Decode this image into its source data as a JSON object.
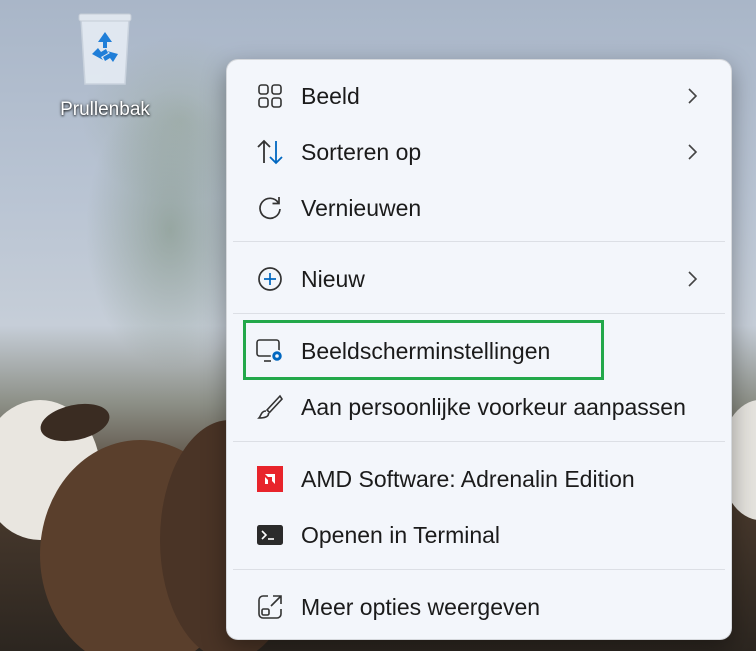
{
  "desktop": {
    "recycle_bin_label": "Prullenbak"
  },
  "menu": {
    "items": [
      {
        "label": "Beeld",
        "icon": "grid-icon",
        "submenu": true
      },
      {
        "label": "Sorteren op",
        "icon": "sort-arrows-icon",
        "submenu": true
      },
      {
        "label": "Vernieuwen",
        "icon": "refresh-icon",
        "submenu": false
      },
      {
        "label": "Nieuw",
        "icon": "plus-circle-icon",
        "submenu": true
      },
      {
        "label": "Beeldscherminstellingen",
        "icon": "display-settings-icon",
        "submenu": false,
        "highlighted": true
      },
      {
        "label": "Aan persoonlijke voorkeur aanpassen",
        "icon": "brush-icon",
        "submenu": false
      },
      {
        "label": "AMD Software: Adrenalin Edition",
        "icon": "amd-logo-icon",
        "submenu": false
      },
      {
        "label": "Openen in Terminal",
        "icon": "terminal-icon",
        "submenu": false
      },
      {
        "label": "Meer opties weergeven",
        "icon": "more-options-icon",
        "submenu": false
      }
    ]
  },
  "colors": {
    "accent": "#0067c0",
    "highlight_border": "#22a84a",
    "amd_red": "#e8242b"
  }
}
